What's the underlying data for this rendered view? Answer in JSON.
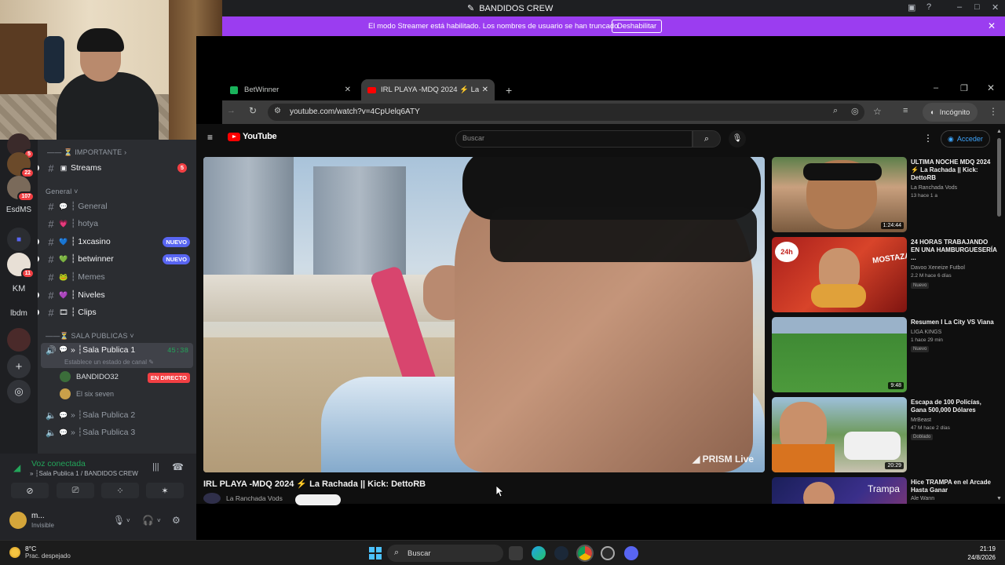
{
  "titlebar": {
    "server_title": "BANDIDOS CREW"
  },
  "streamer_bar": {
    "message": "El modo Streamer está habilitado. Los nombres de usuario se han truncado.",
    "button": "Deshabilitar"
  },
  "rail": {
    "servers": [
      {
        "label": "",
        "badge": "5"
      },
      {
        "label": "",
        "badge": "22"
      },
      {
        "label": "",
        "badge": "107"
      },
      {
        "label": "EsdMS",
        "badge": ""
      },
      {
        "label": "",
        "badge": ""
      },
      {
        "label": "",
        "badge": "11"
      },
      {
        "label": "KM",
        "badge": ""
      },
      {
        "label": "lbdm",
        "badge": ""
      }
    ]
  },
  "channels": {
    "cat_importante": "IMPORTANTE",
    "streams": {
      "emoji": "▣",
      "label": "Streams",
      "count": "5"
    },
    "cat_general": "General",
    "items": [
      {
        "label": "┆ General",
        "emoji": "💬",
        "tag": ""
      },
      {
        "label": "┆ hotya",
        "emoji": "💗",
        "tag": ""
      },
      {
        "label": "┆ 1xcasino",
        "emoji": "💙",
        "tag": "NUEVO"
      },
      {
        "label": "┆ betwinner",
        "emoji": "💚",
        "tag": "NUEVO"
      },
      {
        "label": "┆ Memes",
        "emoji": "🐸",
        "tag": ""
      },
      {
        "label": "┆ Niveles",
        "emoji": "💜",
        "tag": ""
      },
      {
        "label": "┆ Clips",
        "emoji": "🎞",
        "tag": ""
      }
    ],
    "cat_salas": "SALA PUBLICAS",
    "voice_active": {
      "label": "» ┆Sala Publica 1",
      "timer": "45:38",
      "status": "Establece un estado de canal"
    },
    "voice_users": [
      {
        "name": "BANDIDO32",
        "live": "EN DIRECTO"
      },
      {
        "name": "El six seven",
        "live": ""
      }
    ],
    "voice_others": [
      "» ┆Sala Publica 2",
      "» ┆Sala Publica 3"
    ]
  },
  "voice_panel": {
    "status": "Voz conectada",
    "channel": "» ┆Sala Publica 1 / BANDIDOS CREW"
  },
  "user_panel": {
    "name": "m...",
    "status": "Invisible"
  },
  "browser": {
    "tabs": [
      {
        "label": "BetWinner"
      },
      {
        "label": "IRL PLAYA -MDQ 2024 ⚡ La Ra..."
      }
    ],
    "url": "youtube.com/watch?v=4CpUelq6ATY",
    "incognito": "Incógnito"
  },
  "youtube": {
    "logo": "YouTube",
    "search_placeholder": "Buscar",
    "sign_in": "Acceder",
    "video_title": "IRL PLAYA -MDQ 2024 ⚡ La Rachada || Kick: DettoRB",
    "channel": "La Ranchada Vods",
    "watermark": "PRISM Live",
    "recommendations": [
      {
        "title": "ULTIMA NOCHE MDQ 2024 ⚡ La Rachada || Kick: DettoRB",
        "channel": "La Ranchada Vods",
        "meta": "13 hace 1 a",
        "badge": "",
        "duration": "1:24:44",
        "thumb": "#3e6b3a"
      },
      {
        "title": "24 HORAS TRABAJANDO EN UNA HAMBURGUESERÍA ...",
        "channel": "Davoo Xeneize Futbol",
        "meta": "2.2 M hace 6 días",
        "badge": "Nuevo",
        "duration": "",
        "thumb": "#b8231f"
      },
      {
        "title": "Resumen I La City VS Viana",
        "channel": "LIGA KINGS",
        "meta": "1 hace 29 min",
        "badge": "Nuevo",
        "duration": "9:48",
        "thumb": "#3f7e35"
      },
      {
        "title": "Escapa de 100 Policías, Gana 500,000 Dólares",
        "channel": "MrBeast",
        "meta": "47 M hace 2 días",
        "badge": "Doblado",
        "duration": "20:29",
        "thumb": "#5d7d4b"
      },
      {
        "title": "Hice TRAMPA en el Arcade Hasta Ganar",
        "channel": "Ale Wann",
        "meta": "",
        "badge": "",
        "duration": "",
        "thumb": "#2a2f7a"
      }
    ],
    "thumb_text_rec5": "Trampa",
    "thumb_text_rec2": "MOSTAZA"
  },
  "taskbar": {
    "temp": "8°C",
    "weather": "Prac. despejado",
    "search": "Buscar",
    "time": "21:19",
    "date": "24/8/2026"
  }
}
